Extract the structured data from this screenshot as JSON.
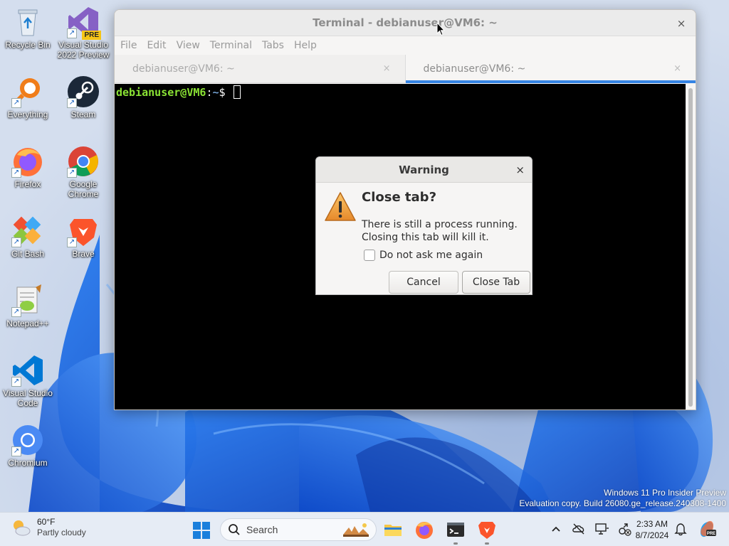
{
  "desktop": {
    "icons": [
      {
        "label": "Recycle Bin",
        "icon": "recycle-bin-icon"
      },
      {
        "label": "Visual Studio 2022 Preview",
        "icon": "visual-studio-icon",
        "badge": "PRE"
      },
      {
        "label": "Everything",
        "icon": "everything-search-icon"
      },
      {
        "label": "Steam",
        "icon": "steam-icon"
      },
      {
        "label": "Firefox",
        "icon": "firefox-icon"
      },
      {
        "label": "Google Chrome",
        "icon": "chrome-icon"
      },
      {
        "label": "Git Bash",
        "icon": "git-bash-icon"
      },
      {
        "label": "Brave",
        "icon": "brave-icon"
      },
      {
        "label": "Notepad++",
        "icon": "notepad-plus-plus-icon"
      },
      {
        "label": "Visual Studio Code",
        "icon": "vscode-icon"
      },
      {
        "label": "Chromium",
        "icon": "chromium-icon"
      }
    ]
  },
  "terminal": {
    "title": "Terminal - debianuser@VM6: ~",
    "close_glyph": "×",
    "menu": [
      "File",
      "Edit",
      "View",
      "Terminal",
      "Tabs",
      "Help"
    ],
    "tabs": [
      {
        "label": "debianuser@VM6: ~",
        "active": false
      },
      {
        "label": "debianuser@VM6: ~",
        "active": true
      }
    ],
    "tab_close_glyph": "×",
    "prompt": {
      "user_host": "debianuser@VM6",
      "sep": ":",
      "path": "~",
      "symbol": "$"
    }
  },
  "dialog": {
    "title": "Warning",
    "close_glyph": "×",
    "heading": "Close tab?",
    "message_line1": "There is still a process running.",
    "message_line2": "Closing this tab will kill it.",
    "checkbox_label": "Do not ask me again",
    "checkbox_checked": false,
    "cancel_label": "Cancel",
    "confirm_label": "Close Tab"
  },
  "watermark": {
    "line1": "Windows 11 Pro Insider Preview",
    "line2": "Evaluation copy. Build 26080.ge_release.240308-1400"
  },
  "taskbar": {
    "weather_temp": "60°F",
    "weather_condition": "Partly cloudy",
    "search_placeholder": "Search",
    "pinned": [
      "file-explorer-icon",
      "firefox-icon",
      "terminal-icon",
      "brave-icon"
    ],
    "clock_time": "2:33 AM",
    "clock_date": "8/7/2024"
  },
  "colors": {
    "accent": "#3584e4",
    "prompt_user": "#8ae234",
    "prompt_path": "#729fcf",
    "terminal_bg": "#000000"
  }
}
